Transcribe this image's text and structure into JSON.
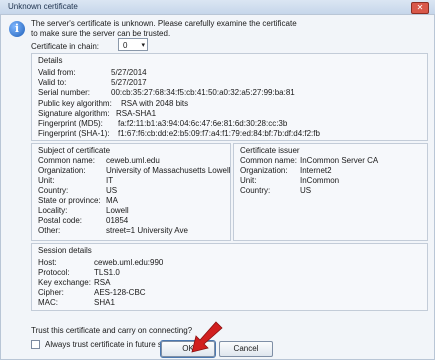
{
  "window": {
    "title": "Unknown certificate",
    "close_glyph": "✕"
  },
  "message": "The server's certificate is unknown. Please carefully examine the certificate to make sure the server can be trusted.",
  "chain": {
    "label": "Certificate in chain:",
    "value": "0",
    "arrow": "▾"
  },
  "details": {
    "title": "Details",
    "rows": [
      {
        "k": "Valid from:",
        "v": "5/27/2014"
      },
      {
        "k": "Valid to:",
        "v": "5/27/2017"
      },
      {
        "k": "Serial number:",
        "v": "00:cb:35:27:68:34:f5:cb:41:50:a0:32:a5:27:99:ba:81"
      },
      {
        "k": "Public key algorithm:",
        "v": "RSA with 2048 bits"
      },
      {
        "k": "Signature algorithm:",
        "v": "RSA-SHA1"
      },
      {
        "k": "Fingerprint (MD5):",
        "v": "fa:f2:11:b1:a3:94:04:6c:47:6e:81:6d:30:28:cc:3b"
      },
      {
        "k": "Fingerprint (SHA-1):",
        "v": "f1:67:f6:cb:dd:e2:b5:09:f7:a4:f1:79:ed:84:bf:7b:df:d4:f2:fb"
      }
    ]
  },
  "subject": {
    "title": "Subject of certificate",
    "rows": [
      {
        "k": "Common name:",
        "v": "ceweb.uml.edu"
      },
      {
        "k": "Organization:",
        "v": "University of Massachusetts Lowell"
      },
      {
        "k": "Unit:",
        "v": "IT"
      },
      {
        "k": "Country:",
        "v": "US"
      },
      {
        "k": "State or province:",
        "v": "MA"
      },
      {
        "k": "Locality:",
        "v": "Lowell"
      },
      {
        "k": "Postal code:",
        "v": "01854"
      },
      {
        "k": "Other:",
        "v": "street=1 University Ave"
      }
    ]
  },
  "issuer": {
    "title": "Certificate issuer",
    "rows": [
      {
        "k": "Common name:",
        "v": "InCommon Server CA"
      },
      {
        "k": "Organization:",
        "v": "Internet2"
      },
      {
        "k": "Unit:",
        "v": "InCommon"
      },
      {
        "k": "Country:",
        "v": "US"
      }
    ]
  },
  "session": {
    "title": "Session details",
    "rows": [
      {
        "k": "Host:",
        "v": "ceweb.uml.edu:990"
      },
      {
        "k": "Protocol:",
        "v": "TLS1.0"
      },
      {
        "k": "Key exchange:",
        "v": "RSA"
      },
      {
        "k": "Cipher:",
        "v": "AES-128-CBC"
      },
      {
        "k": "MAC:",
        "v": "SHA1"
      }
    ]
  },
  "trust_question": "Trust this certificate and carry on connecting?",
  "always_trust_label": "Always trust certificate in future sessions.",
  "buttons": {
    "ok": "OK",
    "cancel": "Cancel"
  },
  "colors": {
    "arrow": "#d11f1f",
    "accent": "#1f5fb8"
  },
  "icons": {
    "info": "info-icon",
    "pointer": "red-arrow-icon"
  }
}
